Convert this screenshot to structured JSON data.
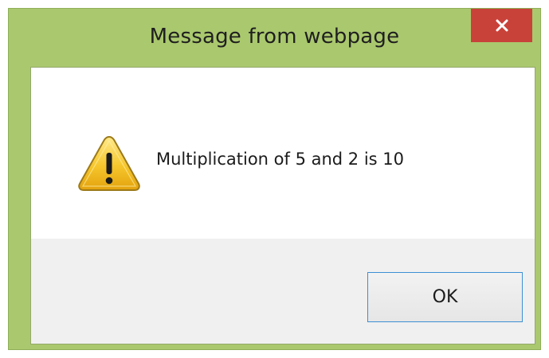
{
  "dialog": {
    "title": "Message from webpage",
    "close_icon": "close-icon",
    "message_icon": "warning-icon",
    "message": "Multiplication of 5 and 2 is 10",
    "ok_label": "OK"
  },
  "colors": {
    "frame": "#aac86e",
    "close_button": "#c9423a",
    "button_area": "#f0f0f0",
    "ok_border": "#3c8fd6"
  }
}
